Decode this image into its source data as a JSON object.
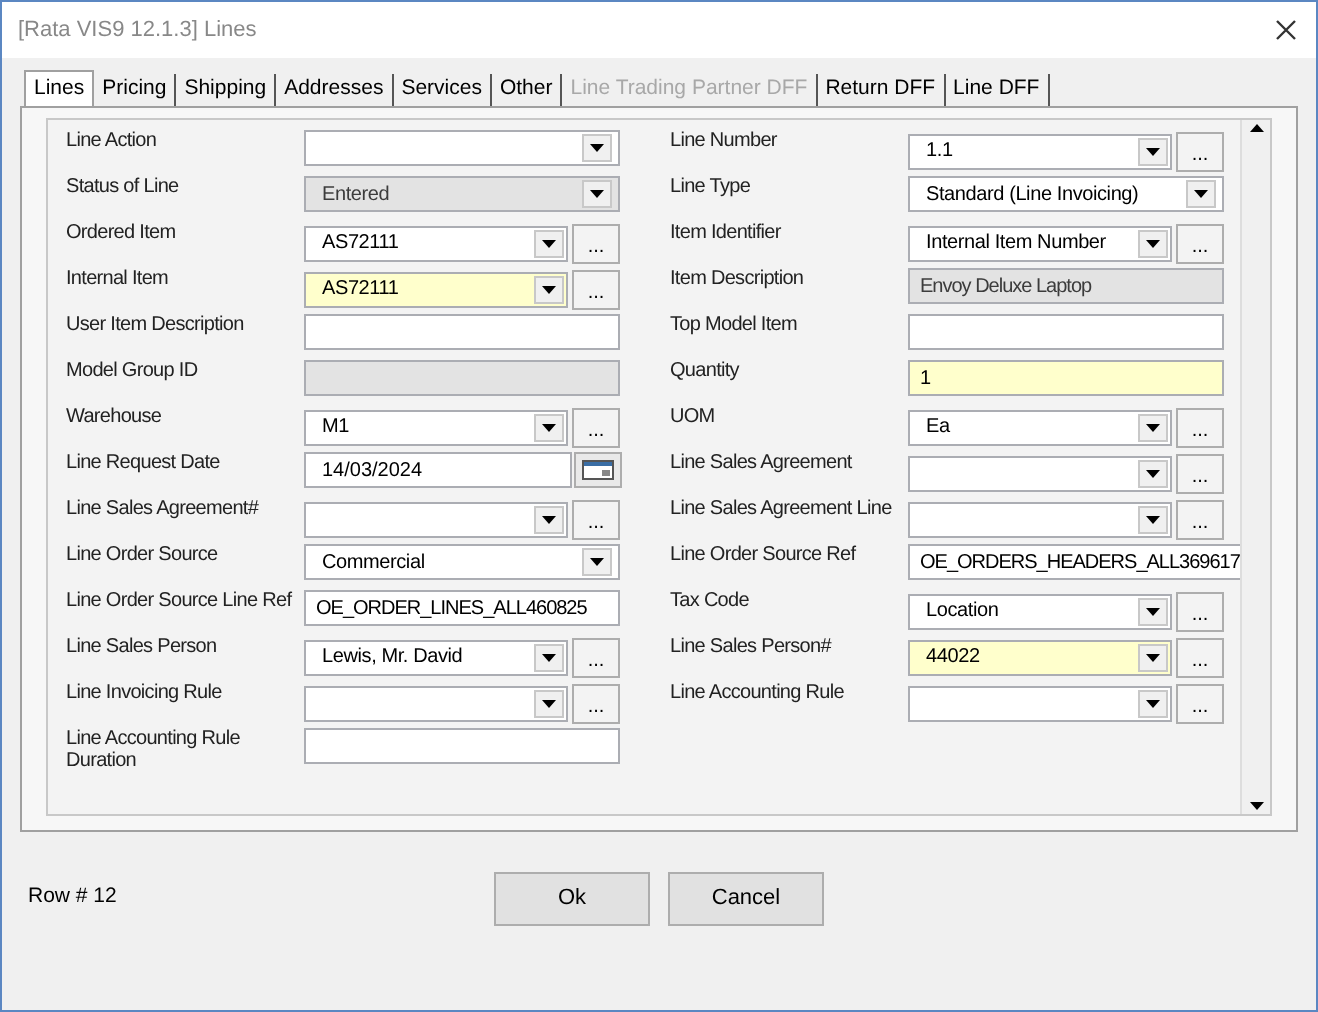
{
  "window": {
    "title": "[Rata VIS9 12.1.3] Lines"
  },
  "tabs": [
    {
      "label": "Lines",
      "selected": true,
      "disabled": false
    },
    {
      "label": "Pricing",
      "selected": false,
      "disabled": false
    },
    {
      "label": "Shipping",
      "selected": false,
      "disabled": false
    },
    {
      "label": "Addresses",
      "selected": false,
      "disabled": false
    },
    {
      "label": "Services",
      "selected": false,
      "disabled": false
    },
    {
      "label": "Other",
      "selected": false,
      "disabled": false
    },
    {
      "label": "Line Trading Partner DFF",
      "selected": false,
      "disabled": true
    },
    {
      "label": "Return DFF",
      "selected": false,
      "disabled": false
    },
    {
      "label": "Line DFF",
      "selected": false,
      "disabled": false
    }
  ],
  "left_fields": [
    {
      "label": "Line Action",
      "kind": "combo",
      "required": false,
      "disabled": false
    },
    {
      "label": "Status of Line",
      "kind": "combo",
      "value": "Entered",
      "required": false,
      "disabled": true
    },
    {
      "label": "Ordered Item",
      "kind": "combo",
      "value": "AS72111",
      "required": false,
      "disabled": false,
      "lookup": "..."
    },
    {
      "label": "Internal Item",
      "kind": "combo",
      "value": "AS72111",
      "required": true,
      "disabled": false,
      "lookup": "..."
    },
    {
      "label": "User Item Description",
      "kind": "text",
      "required": false,
      "disabled": false
    },
    {
      "label": "Model Group ID",
      "kind": "text",
      "required": false,
      "disabled": true
    },
    {
      "label": "Warehouse",
      "kind": "combo",
      "value": "M1",
      "required": false,
      "disabled": false,
      "lookup": "..."
    },
    {
      "label": "Line Request Date",
      "kind": "date",
      "value": "14/03/2024",
      "required": false,
      "disabled": false
    },
    {
      "label": "Line Sales Agreement#",
      "kind": "combo",
      "required": false,
      "disabled": false,
      "lookup": "..."
    },
    {
      "label": "Line Order Source",
      "kind": "combo",
      "value": "Commercial",
      "required": false,
      "disabled": false
    },
    {
      "label": "Line Order Source Line Ref",
      "kind": "text",
      "value": "OE_ORDER_LINES_ALL460825",
      "required": false,
      "disabled": false
    },
    {
      "label": "Line Sales Person",
      "kind": "combo",
      "value": "Lewis, Mr. David",
      "required": false,
      "disabled": false,
      "lookup": "..."
    },
    {
      "label": "Line Invoicing Rule",
      "kind": "combo",
      "required": false,
      "disabled": false,
      "lookup": "..."
    },
    {
      "label": "Line Accounting Rule Duration",
      "kind": "text",
      "required": false,
      "disabled": false
    }
  ],
  "right_fields": [
    {
      "label": "Line Number",
      "kind": "combo",
      "value": "1.1",
      "required": false,
      "disabled": false,
      "lookup": "..."
    },
    {
      "label": "Line Type",
      "kind": "combo",
      "value": "Standard (Line Invoicing)",
      "required": false,
      "disabled": false
    },
    {
      "label": "Item Identifier",
      "kind": "combo",
      "value": "Internal Item Number",
      "required": false,
      "disabled": false,
      "lookup": "..."
    },
    {
      "label": "Item Description",
      "kind": "text",
      "value": "Envoy Deluxe Laptop",
      "required": false,
      "disabled": true
    },
    {
      "label": "Top Model Item",
      "kind": "text",
      "required": false,
      "disabled": false
    },
    {
      "label": "Quantity",
      "kind": "text",
      "value": "1",
      "required": true,
      "disabled": false
    },
    {
      "label": "UOM",
      "kind": "combo",
      "value": "Ea",
      "required": false,
      "disabled": false,
      "lookup": "..."
    },
    {
      "label": "Line Sales Agreement",
      "kind": "combo",
      "required": false,
      "disabled": false,
      "lookup": "..."
    },
    {
      "label": "Line Sales Agreement Line",
      "kind": "combo",
      "required": false,
      "disabled": false,
      "lookup": "..."
    },
    {
      "label": "Line Order Source Ref",
      "kind": "text",
      "value": "OE_ORDERS_HEADERS_ALL369617",
      "required": false,
      "disabled": false
    },
    {
      "label": "Tax Code",
      "kind": "combo",
      "value": "Location",
      "required": false,
      "disabled": false,
      "lookup": "..."
    },
    {
      "label": "Line Sales Person#",
      "kind": "combo",
      "value": "44022",
      "required": true,
      "disabled": false,
      "lookup": "..."
    },
    {
      "label": "Line Accounting Rule",
      "kind": "combo",
      "required": false,
      "disabled": false,
      "lookup": "..."
    }
  ],
  "status": {
    "row": "Row # 12"
  },
  "buttons": [
    "Ok",
    "Cancel"
  ]
}
